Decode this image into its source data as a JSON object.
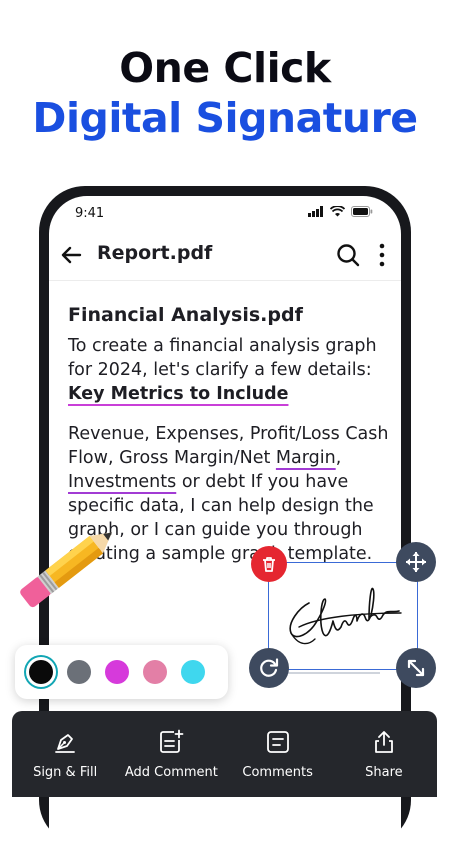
{
  "headline": {
    "line1": "One Click",
    "line2": "Digital Signature"
  },
  "status_bar": {
    "time": "9:41"
  },
  "app_bar": {
    "title": "Report.pdf"
  },
  "document": {
    "title": "Financial Analysis.pdf",
    "para1_text": "To create a financial analysis graph for 2024, let's clarify a few details: ",
    "para1_highlight": "Key Metrics to Include",
    "para2_text_a": "Revenue, Expenses, Profit/Loss Cash Flow, Gross Margin/Net ",
    "para2_highlight_a": "Margin",
    "para2_text_b": ", ",
    "para2_highlight_b": "Investments",
    "para2_text_c": " or debt If you have specific data, I can help design the graph, or I can guide you through creating a sample graph template."
  },
  "palette": {
    "colors": [
      "#0a0a0a",
      "#6b7078",
      "#d63adb",
      "#e37fa6",
      "#3fd7ee"
    ],
    "selected_index": 0
  },
  "toolbar": {
    "items": [
      {
        "label": "Sign & Fill",
        "icon": "pen-nib-icon"
      },
      {
        "label": "Add Comment",
        "icon": "add-comment-icon"
      },
      {
        "label": "Comments",
        "icon": "comments-icon"
      },
      {
        "label": "Share",
        "icon": "share-icon"
      }
    ]
  },
  "accent_colors": {
    "headline_blue": "#1a4fe0",
    "handle": "#3e4a5f",
    "delete": "#e52630",
    "toolbar_bg": "#25272c"
  }
}
